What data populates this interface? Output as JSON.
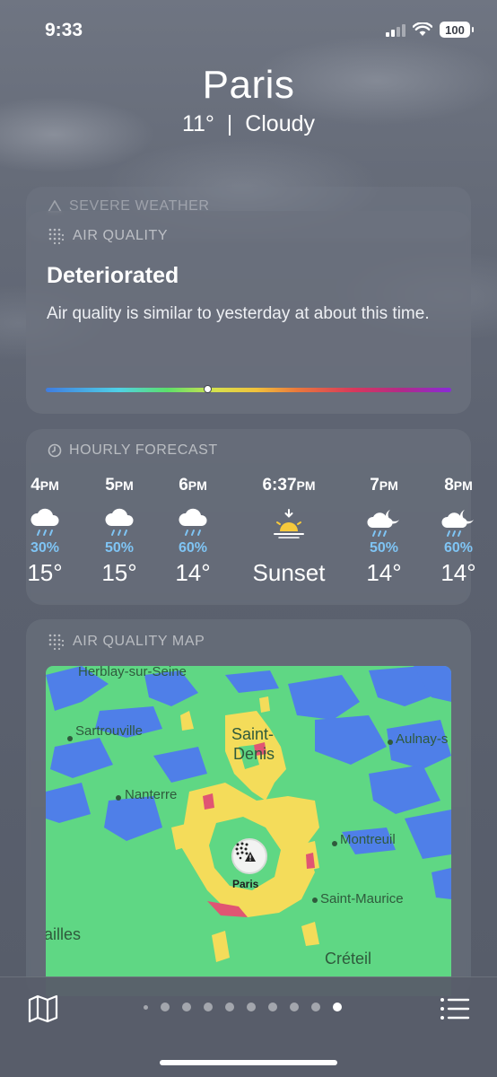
{
  "status_bar": {
    "time": "9:33",
    "battery": "100"
  },
  "header": {
    "city": "Paris",
    "summary": "11°  |  Cloudy"
  },
  "severe_card": {
    "label": "SEVERE WEATHER"
  },
  "air_quality": {
    "label": "AIR QUALITY",
    "title": "Deteriorated",
    "description": "Air quality is similar to yesterday at about this time.",
    "level_fraction": 0.4
  },
  "hourly": {
    "label": "HOURLY FORECAST",
    "items": [
      {
        "hour": "4",
        "ampm": "PM",
        "precip": "30%",
        "temp": "15°",
        "icon": "cloud-rain-icon"
      },
      {
        "hour": "5",
        "ampm": "PM",
        "precip": "50%",
        "temp": "15°",
        "icon": "cloud-rain-icon"
      },
      {
        "hour": "6",
        "ampm": "PM",
        "precip": "60%",
        "temp": "14°",
        "icon": "cloud-rain-icon"
      },
      {
        "hour": "6:37",
        "ampm": "PM",
        "precip": "",
        "temp": "Sunset",
        "icon": "sunset-icon"
      },
      {
        "hour": "7",
        "ampm": "PM",
        "precip": "50%",
        "temp": "14°",
        "icon": "cloud-moon-rain-icon"
      },
      {
        "hour": "8",
        "ampm": "PM",
        "precip": "60%",
        "temp": "14°",
        "icon": "cloud-moon-rain-icon"
      }
    ]
  },
  "aq_map": {
    "label": "AIR QUALITY MAP",
    "places": {
      "herblay": "Herblay-sur-Seine",
      "sartrouville": "Sartrouville",
      "saint_denis_1": "Saint-",
      "saint_denis_2": "Denis",
      "aulnay": "Aulnay-s",
      "nanterre": "Nanterre",
      "montreuil": "Montreuil",
      "paris": "Paris",
      "saint_maurice": "Saint-Maurice",
      "versailles": "ailles",
      "creteil": "Créteil"
    }
  },
  "bottom_bar": {
    "page_count": 10,
    "active_page": 9
  }
}
